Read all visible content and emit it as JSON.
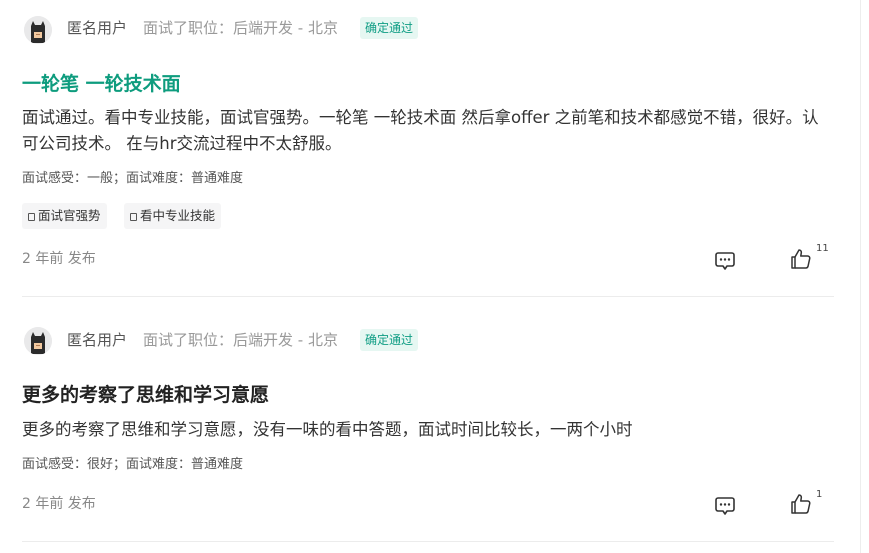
{
  "reviews": [
    {
      "username": "匿名用户",
      "position": "面试了职位：后端开发 - 北京",
      "badge": "确定通过",
      "title": "一轮笔 一轮技术面",
      "title_color": "#0e9c7e",
      "body": "面试通过。看中专业技能，面试官强势。一轮笔 一轮技术面 然后拿offer 之前笔和技术都感觉不错，很好。认可公司技术。 在与hr交流过程中不太舒服。",
      "meta": "面试感受：一般；面试难度：普通难度",
      "tags": [
        "面试官强势",
        "看中专业技能"
      ],
      "time": "2 年前 发布",
      "likes": "11",
      "comment_icon": "comment-icon",
      "like_icon": "thumbs-up-icon"
    },
    {
      "username": "匿名用户",
      "position": "面试了职位：后端开发 - 北京",
      "badge": "确定通过",
      "title": "更多的考察了思维和学习意愿",
      "title_color": "#222222",
      "body": "更多的考察了思维和学习意愿，没有一味的看中答题，面试时间比较长，一两个小时",
      "meta": "面试感受：很好；面试难度：普通难度",
      "time": "2 年前 发布",
      "likes": "1",
      "comment_icon": "comment-icon",
      "like_icon": "thumbs-up-icon"
    }
  ]
}
